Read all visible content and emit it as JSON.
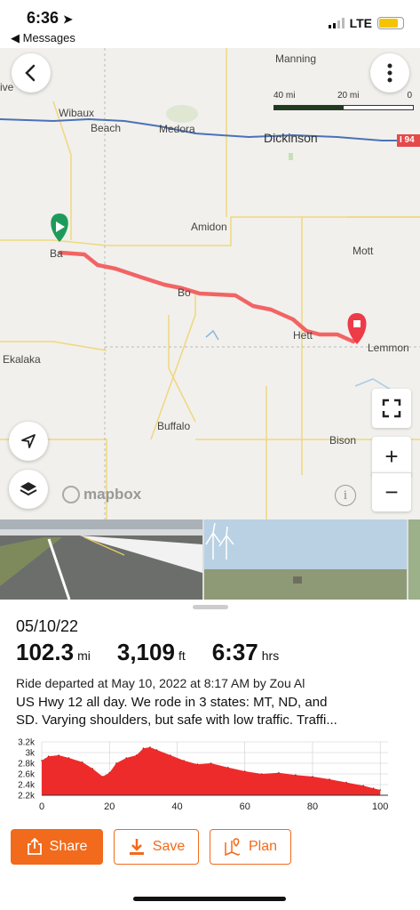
{
  "status_bar": {
    "time": "6:36",
    "back_app": "◀ Messages",
    "network": "LTE",
    "battery_level": 0.8
  },
  "map": {
    "back_icon": "chevron-left-icon",
    "more_icon": "more-vertical-icon",
    "scale": {
      "left": "40 mi",
      "middle": "20 mi",
      "right": "0"
    },
    "labels": {
      "manning": "Manning",
      "wibaux": "Wibaux",
      "beach": "Beach",
      "medora": "Medora",
      "dickinson": "Dickinson",
      "amidon": "Amidon",
      "mott": "Mott",
      "baker": "Ba",
      "bowman": "Bo",
      "hettinger": "Hett",
      "lemmon": "Lemmon",
      "ekalaka": "Ekalaka",
      "buffalo": "Buffalo",
      "bison": "Bison",
      "divide": "ive",
      "interstate": "I 94"
    },
    "attribution": "mapbox",
    "fullscreen_icon": "fullscreen-icon",
    "zoom_in": "+",
    "zoom_out": "−",
    "locate_icon": "navigation-arrow-icon",
    "layers_icon": "layers-icon",
    "info": "i",
    "start_color": "#1e9b5a",
    "end_color": "#ee3b48",
    "route_color": "#f26464"
  },
  "ride": {
    "date": "05/10/22",
    "distance_value": "102.3",
    "distance_unit": "mi",
    "elevation_value": "3,109",
    "elevation_unit": "ft",
    "time_value": "6:37",
    "time_unit": "hrs",
    "departed": "Ride departed at May 10, 2022 at 8:17 AM by Zou Al",
    "description_line1": "US Hwy 12 all day.  We rode in 3 states: MT, ND, and",
    "description_line2": "SD.  Varying shoulders, but safe with low traffic.  Traffi..."
  },
  "chart_data": {
    "type": "area",
    "title": "",
    "xlabel": "",
    "ylabel": "",
    "x": [
      0,
      2,
      5,
      8,
      12,
      15,
      18,
      20,
      22,
      25,
      28,
      30,
      32,
      34,
      38,
      42,
      46,
      50,
      55,
      60,
      65,
      70,
      75,
      80,
      85,
      90,
      95,
      98,
      100
    ],
    "y": [
      2850,
      2930,
      2950,
      2900,
      2820,
      2700,
      2550,
      2620,
      2800,
      2900,
      2950,
      3080,
      3100,
      3050,
      2950,
      2850,
      2780,
      2800,
      2720,
      2650,
      2600,
      2620,
      2580,
      2550,
      2500,
      2440,
      2380,
      2330,
      2300
    ],
    "xlim": [
      0,
      102.3
    ],
    "ylim": [
      2200,
      3200
    ],
    "x_ticks": [
      "0",
      "20",
      "40",
      "60",
      "80",
      "100"
    ],
    "y_ticks": [
      "3.2k",
      "3k",
      "2.8k",
      "2.6k",
      "2.4k",
      "2.2k"
    ],
    "fill_color": "#ee2b2b",
    "grid": true
  },
  "actions": {
    "share": "Share",
    "save": "Save",
    "plan": "Plan",
    "share_icon": "share-icon",
    "save_icon": "download-icon",
    "plan_icon": "map-pin-icon",
    "accent": "#f26a1b"
  }
}
